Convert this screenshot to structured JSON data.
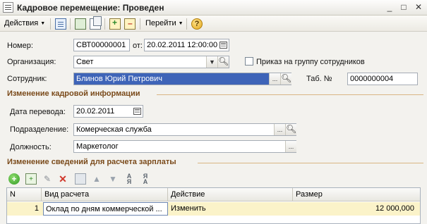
{
  "window": {
    "title": "Кадровое перемещение: Проведен",
    "min_label": "_",
    "max_label": "□",
    "close_label": "✕"
  },
  "toolbar": {
    "actions_label": "Действия",
    "goto_label": "Перейти",
    "help_label": "?"
  },
  "form": {
    "number_label": "Номер:",
    "number_value": "СВТ00000001",
    "from_label": "от:",
    "date_value": "20.02.2011 12:00:00",
    "org_label": "Организация:",
    "org_value": "Свет",
    "group_order_label": "Приказ на группу сотрудников",
    "group_order_checked": false,
    "employee_label": "Сотрудник:",
    "employee_value": "Блинов Юрий Петрович",
    "tab_label": "Таб. №",
    "tab_value": "0000000004"
  },
  "section_personnel": {
    "title": "Изменение кадровой информации",
    "transfer_date_label": "Дата перевода:",
    "transfer_date_value": "20.02.2011",
    "department_label": "Подразделение:",
    "department_value": "Комерческая служба",
    "position_label": "Должность:",
    "position_value": "Маркетолог"
  },
  "section_salary": {
    "title": "Изменение сведений для расчета зарплаты",
    "columns": [
      "N",
      "Вид расчета",
      "Действие",
      "Размер"
    ],
    "rows": [
      {
        "n": "1",
        "type": "Оклад по дням коммерческой ...",
        "action": "Изменить",
        "amount": "12 000,000"
      }
    ]
  },
  "colors": {
    "selection": "#3e64b8",
    "section_title": "#7a4a1a",
    "row_highlight": "#fbf3c9"
  },
  "icons": [
    "app-icon",
    "form-icon",
    "image-icon",
    "copy-icon",
    "post-icon",
    "unpost-icon",
    "help-icon",
    "calendar-icon",
    "search-icon",
    "add-icon",
    "delete-icon",
    "sort-asc-icon",
    "sort-desc-icon"
  ]
}
